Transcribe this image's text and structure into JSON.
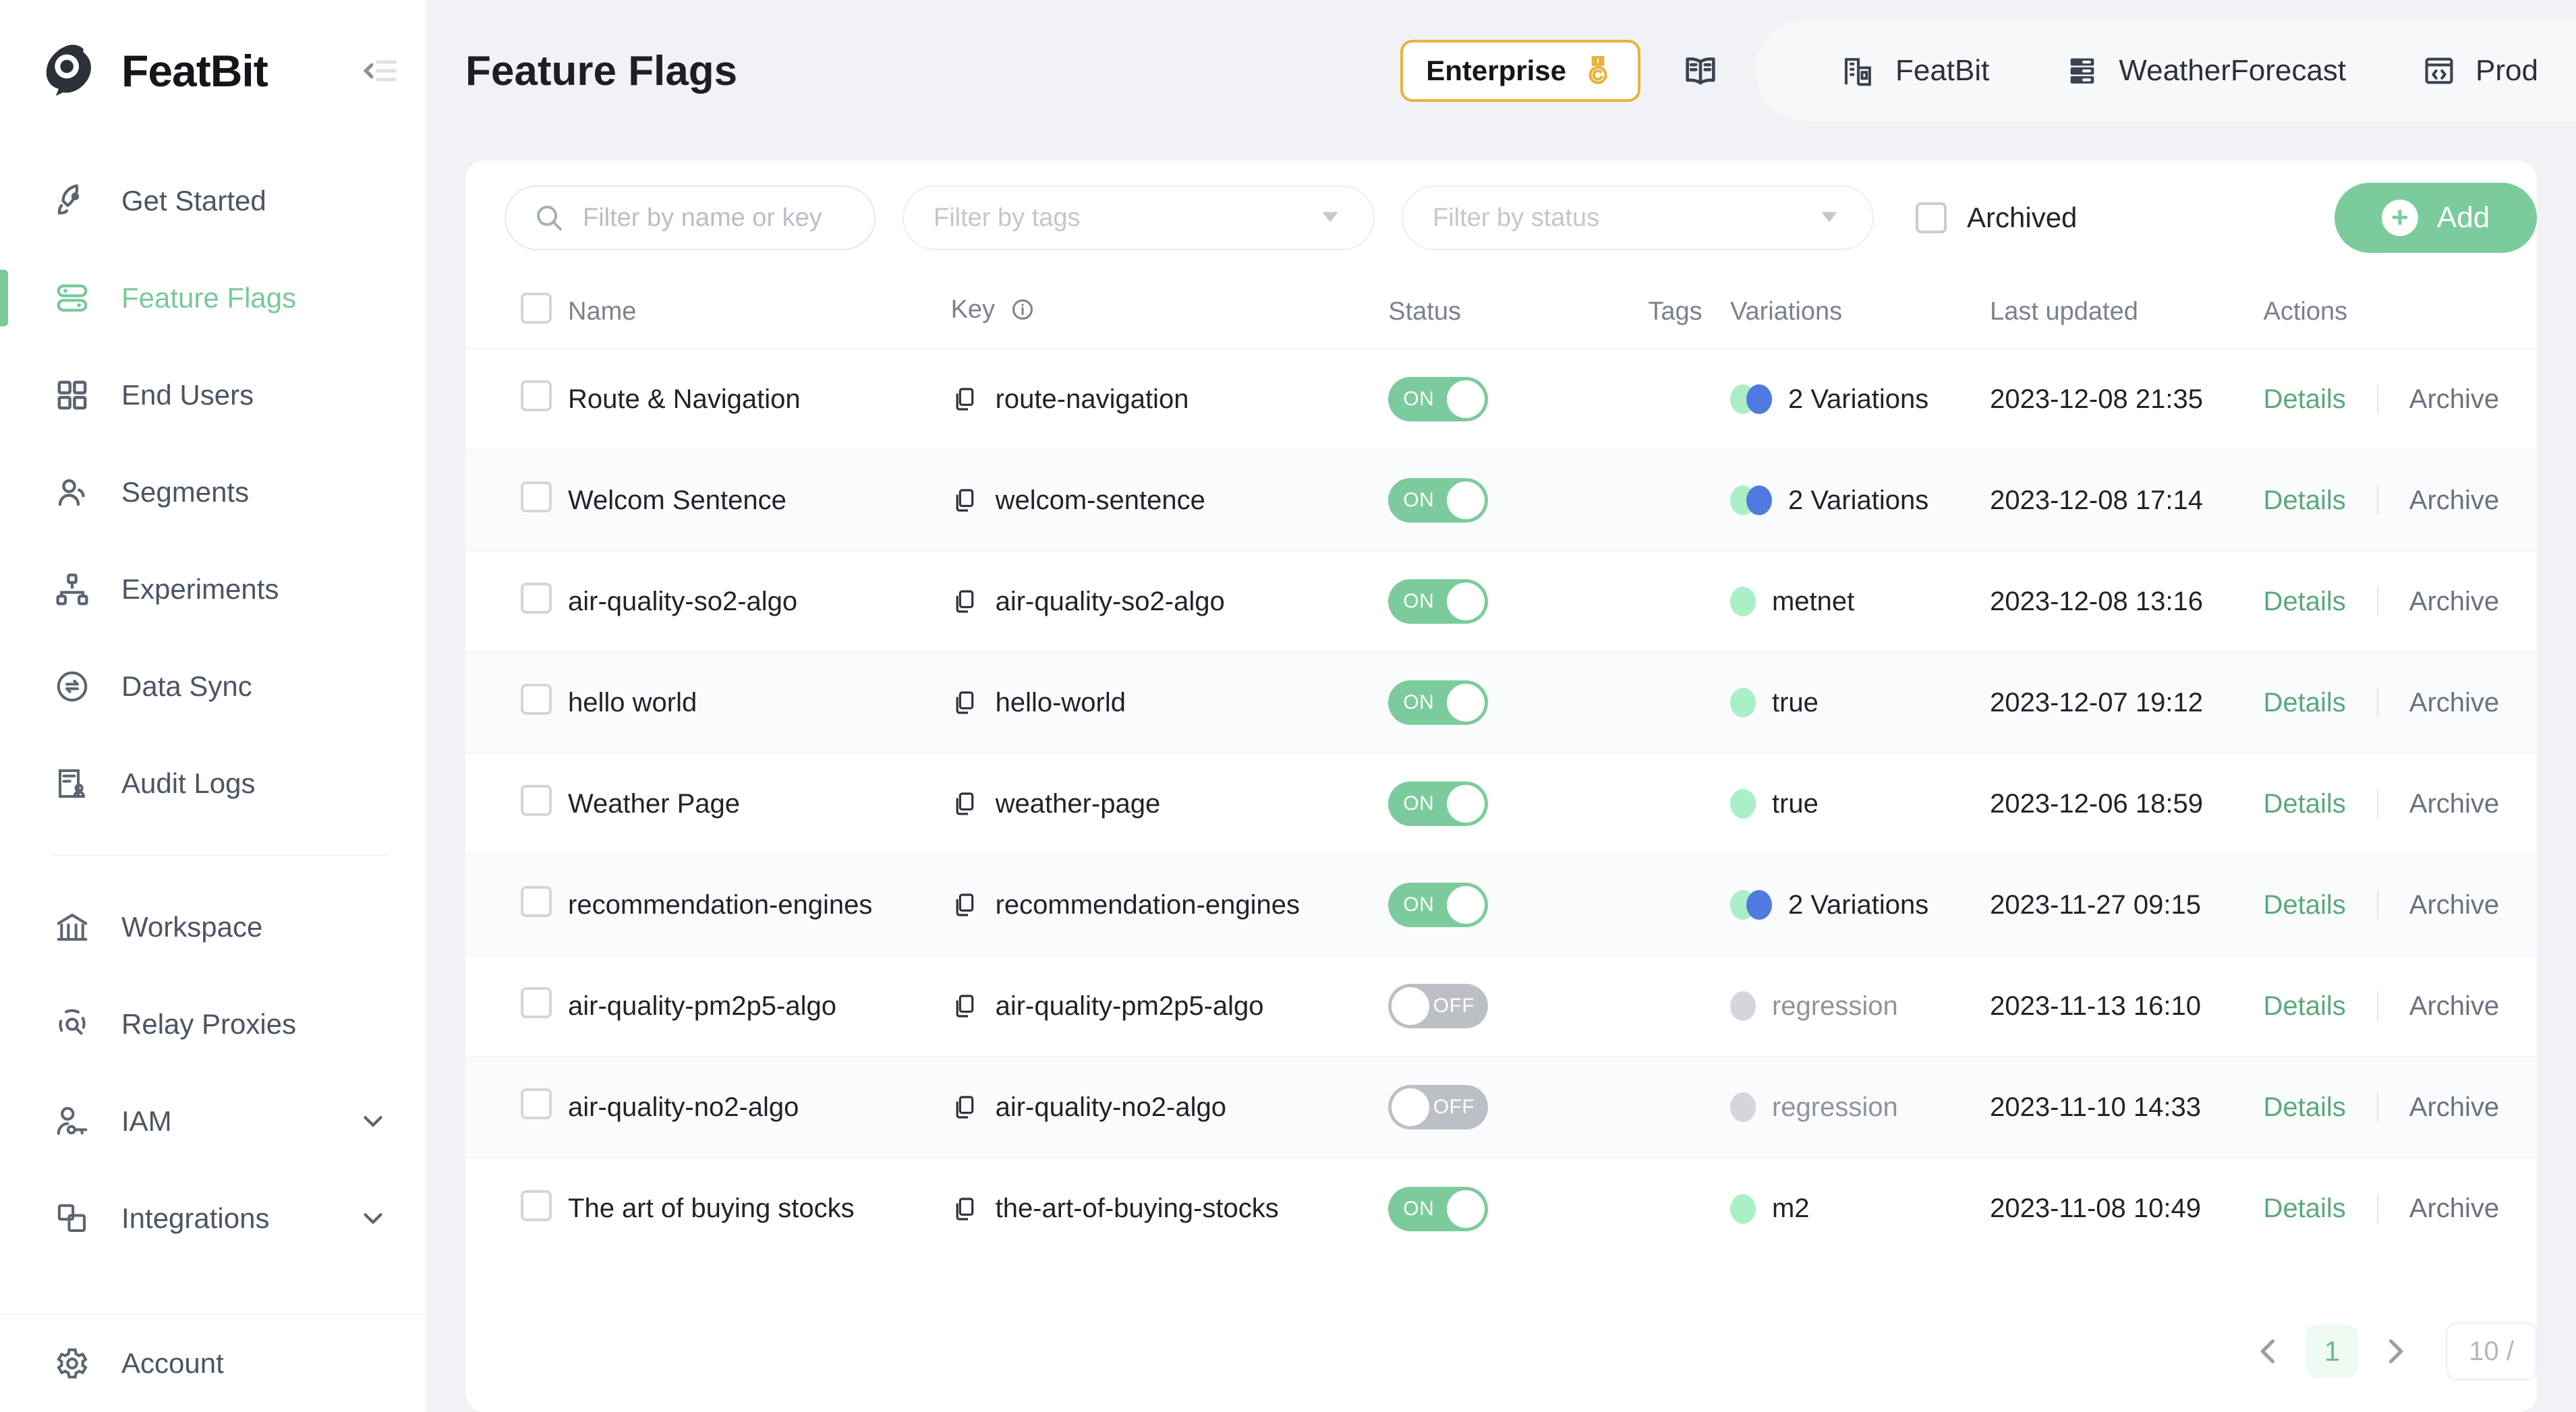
{
  "brand": {
    "name": "FeatBit",
    "logo_icon": "featbit-logo-icon",
    "collapse_icon": "collapse-sidebar-icon"
  },
  "sidebar": {
    "items": [
      {
        "label": "Get Started",
        "icon": "rocket-icon",
        "active": false,
        "expandable": false
      },
      {
        "label": "Feature Flags",
        "icon": "toggle-list-icon",
        "active": true,
        "expandable": false
      },
      {
        "label": "End Users",
        "icon": "grid-icon",
        "active": false,
        "expandable": false
      },
      {
        "label": "Segments",
        "icon": "users-icon",
        "active": false,
        "expandable": false
      },
      {
        "label": "Experiments",
        "icon": "sitemap-icon",
        "active": false,
        "expandable": false
      },
      {
        "label": "Data Sync",
        "icon": "sync-icon",
        "active": false,
        "expandable": false
      },
      {
        "label": "Audit Logs",
        "icon": "audit-document-icon",
        "active": false,
        "expandable": false
      }
    ],
    "items2": [
      {
        "label": "Workspace",
        "icon": "bank-icon",
        "active": false,
        "expandable": false
      },
      {
        "label": "Relay Proxies",
        "icon": "relay-icon",
        "active": false,
        "expandable": false
      },
      {
        "label": "IAM",
        "icon": "user-key-icon",
        "active": false,
        "expandable": true
      },
      {
        "label": "Integrations",
        "icon": "layers-icon",
        "active": false,
        "expandable": true
      }
    ],
    "account": {
      "label": "Account",
      "icon": "gear-icon"
    }
  },
  "header": {
    "title": "Feature Flags",
    "plan": {
      "label": "Enterprise",
      "icon": "medal-icon",
      "color": "#e8b33c"
    },
    "docs_icon": "book-icon",
    "environment": [
      {
        "label": "FeatBit",
        "icon": "organization-icon"
      },
      {
        "label": "WeatherForecast",
        "icon": "project-icon"
      },
      {
        "label": "Prod",
        "icon": "code-env-icon"
      }
    ]
  },
  "filters": {
    "search_placeholder": "Filter by name or key",
    "search_value": "",
    "search_icon": "search-icon",
    "tags_placeholder": "Filter by tags",
    "status_placeholder": "Filter by status",
    "archived_label": "Archived",
    "archived_checked": false,
    "add_label": "Add",
    "add_icon": "plus-circle-icon"
  },
  "table": {
    "columns": [
      "Name",
      "Key",
      "Status",
      "Tags",
      "Variations",
      "Last updated",
      "Actions"
    ],
    "key_info_icon": "info-icon",
    "copy_icon": "copy-icon",
    "actions": {
      "details": "Details",
      "archive": "Archive"
    },
    "toggle_on_label": "ON",
    "toggle_off_label": "OFF",
    "rows": [
      {
        "name": "Route & Navigation",
        "key": "route-navigation",
        "status": "ON",
        "tags": "",
        "variation": "2 Variations",
        "variation_type": "multi",
        "updated": "2023-12-08 21:35"
      },
      {
        "name": "Welcom Sentence",
        "key": "welcom-sentence",
        "status": "ON",
        "tags": "",
        "variation": "2 Variations",
        "variation_type": "multi",
        "updated": "2023-12-08 17:14"
      },
      {
        "name": "air-quality-so2-algo",
        "key": "air-quality-so2-algo",
        "status": "ON",
        "tags": "",
        "variation": "metnet",
        "variation_type": "single",
        "updated": "2023-12-08 13:16"
      },
      {
        "name": "hello world",
        "key": "hello-world",
        "status": "ON",
        "tags": "",
        "variation": "true",
        "variation_type": "single",
        "updated": "2023-12-07 19:12"
      },
      {
        "name": "Weather Page",
        "key": "weather-page",
        "status": "ON",
        "tags": "",
        "variation": "true",
        "variation_type": "single",
        "updated": "2023-12-06 18:59"
      },
      {
        "name": "recommendation-engines",
        "key": "recommendation-engines",
        "status": "ON",
        "tags": "",
        "variation": "2 Variations",
        "variation_type": "multi",
        "updated": "2023-11-27 09:15"
      },
      {
        "name": "air-quality-pm2p5-algo",
        "key": "air-quality-pm2p5-algo",
        "status": "OFF",
        "tags": "",
        "variation": "regression",
        "variation_type": "off",
        "updated": "2023-11-13 16:10"
      },
      {
        "name": "air-quality-no2-algo",
        "key": "air-quality-no2-algo",
        "status": "OFF",
        "tags": "",
        "variation": "regression",
        "variation_type": "off",
        "updated": "2023-11-10 14:33"
      },
      {
        "name": "The art of buying stocks",
        "key": "the-art-of-buying-stocks",
        "status": "ON",
        "tags": "",
        "variation": "m2",
        "variation_type": "single",
        "updated": "2023-11-08 10:49"
      }
    ]
  },
  "pagination": {
    "prev_icon": "chevron-left-icon",
    "next_icon": "chevron-right-icon",
    "current_page": "1",
    "page_size": "10 /"
  },
  "colors": {
    "accent_green": "#7ccb9c",
    "plan_gold": "#e8b33c",
    "variation_blue": "#4f7ae0",
    "variation_green": "#abefc6",
    "off_gray": "#bcc0c6"
  }
}
